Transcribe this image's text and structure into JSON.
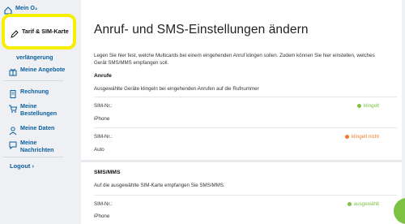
{
  "sidebar": {
    "items": [
      {
        "label": "Mein O₂",
        "icon": "home-icon"
      },
      {
        "label": "Tarif & SIM-Karte",
        "icon": "pencil-icon"
      },
      {
        "label": "verlängerung",
        "icon": ""
      },
      {
        "label": "Meine Angebote",
        "icon": "gift-icon"
      },
      {
        "label": "Rechnung",
        "icon": "invoice-icon"
      },
      {
        "label": "Meine Bestellungen",
        "icon": "cart-icon"
      },
      {
        "label": "Meine Daten",
        "icon": "user-icon"
      },
      {
        "label": "Meine Nachrichten",
        "icon": "message-icon"
      }
    ],
    "logout": "Logout ›"
  },
  "main": {
    "title": "Anruf- und SMS-Einstellungen ändern",
    "intro": "Legen Sie hier fest, welche Multicards bei einem eingehenden Anruf klingen sollen. Zudem können Sie hier einstellen, welches Gerät SMS/MMS empfangen soll.",
    "calls": {
      "title": "Anrufe",
      "desc": "Ausgewählte Geräte klingeln bei eingehenden Anrufen auf die Rufnummer",
      "rows": [
        {
          "sim_label": "SIM-Nr.:",
          "device": "iPhone",
          "status": "klingelt",
          "status_color": "#7dc242"
        },
        {
          "sim_label": "SIM-Nr.:",
          "device": "Auto",
          "status": "klingelt nicht",
          "status_color": "#f07c2a"
        }
      ]
    },
    "sms": {
      "title": "SMS/MMS",
      "desc": "Auf die ausgewählte SIM-Karte empfangen Sie SMS/MMS.",
      "rows": [
        {
          "sim_label": "SIM-Nr.:",
          "device": "iPhone",
          "status": "ausgewählt",
          "status_color": "#7dc242"
        }
      ]
    }
  },
  "colors": {
    "brand_blue": "#0a5f9e",
    "highlight": "#f6f000",
    "green": "#7dc242",
    "orange": "#f07c2a"
  }
}
